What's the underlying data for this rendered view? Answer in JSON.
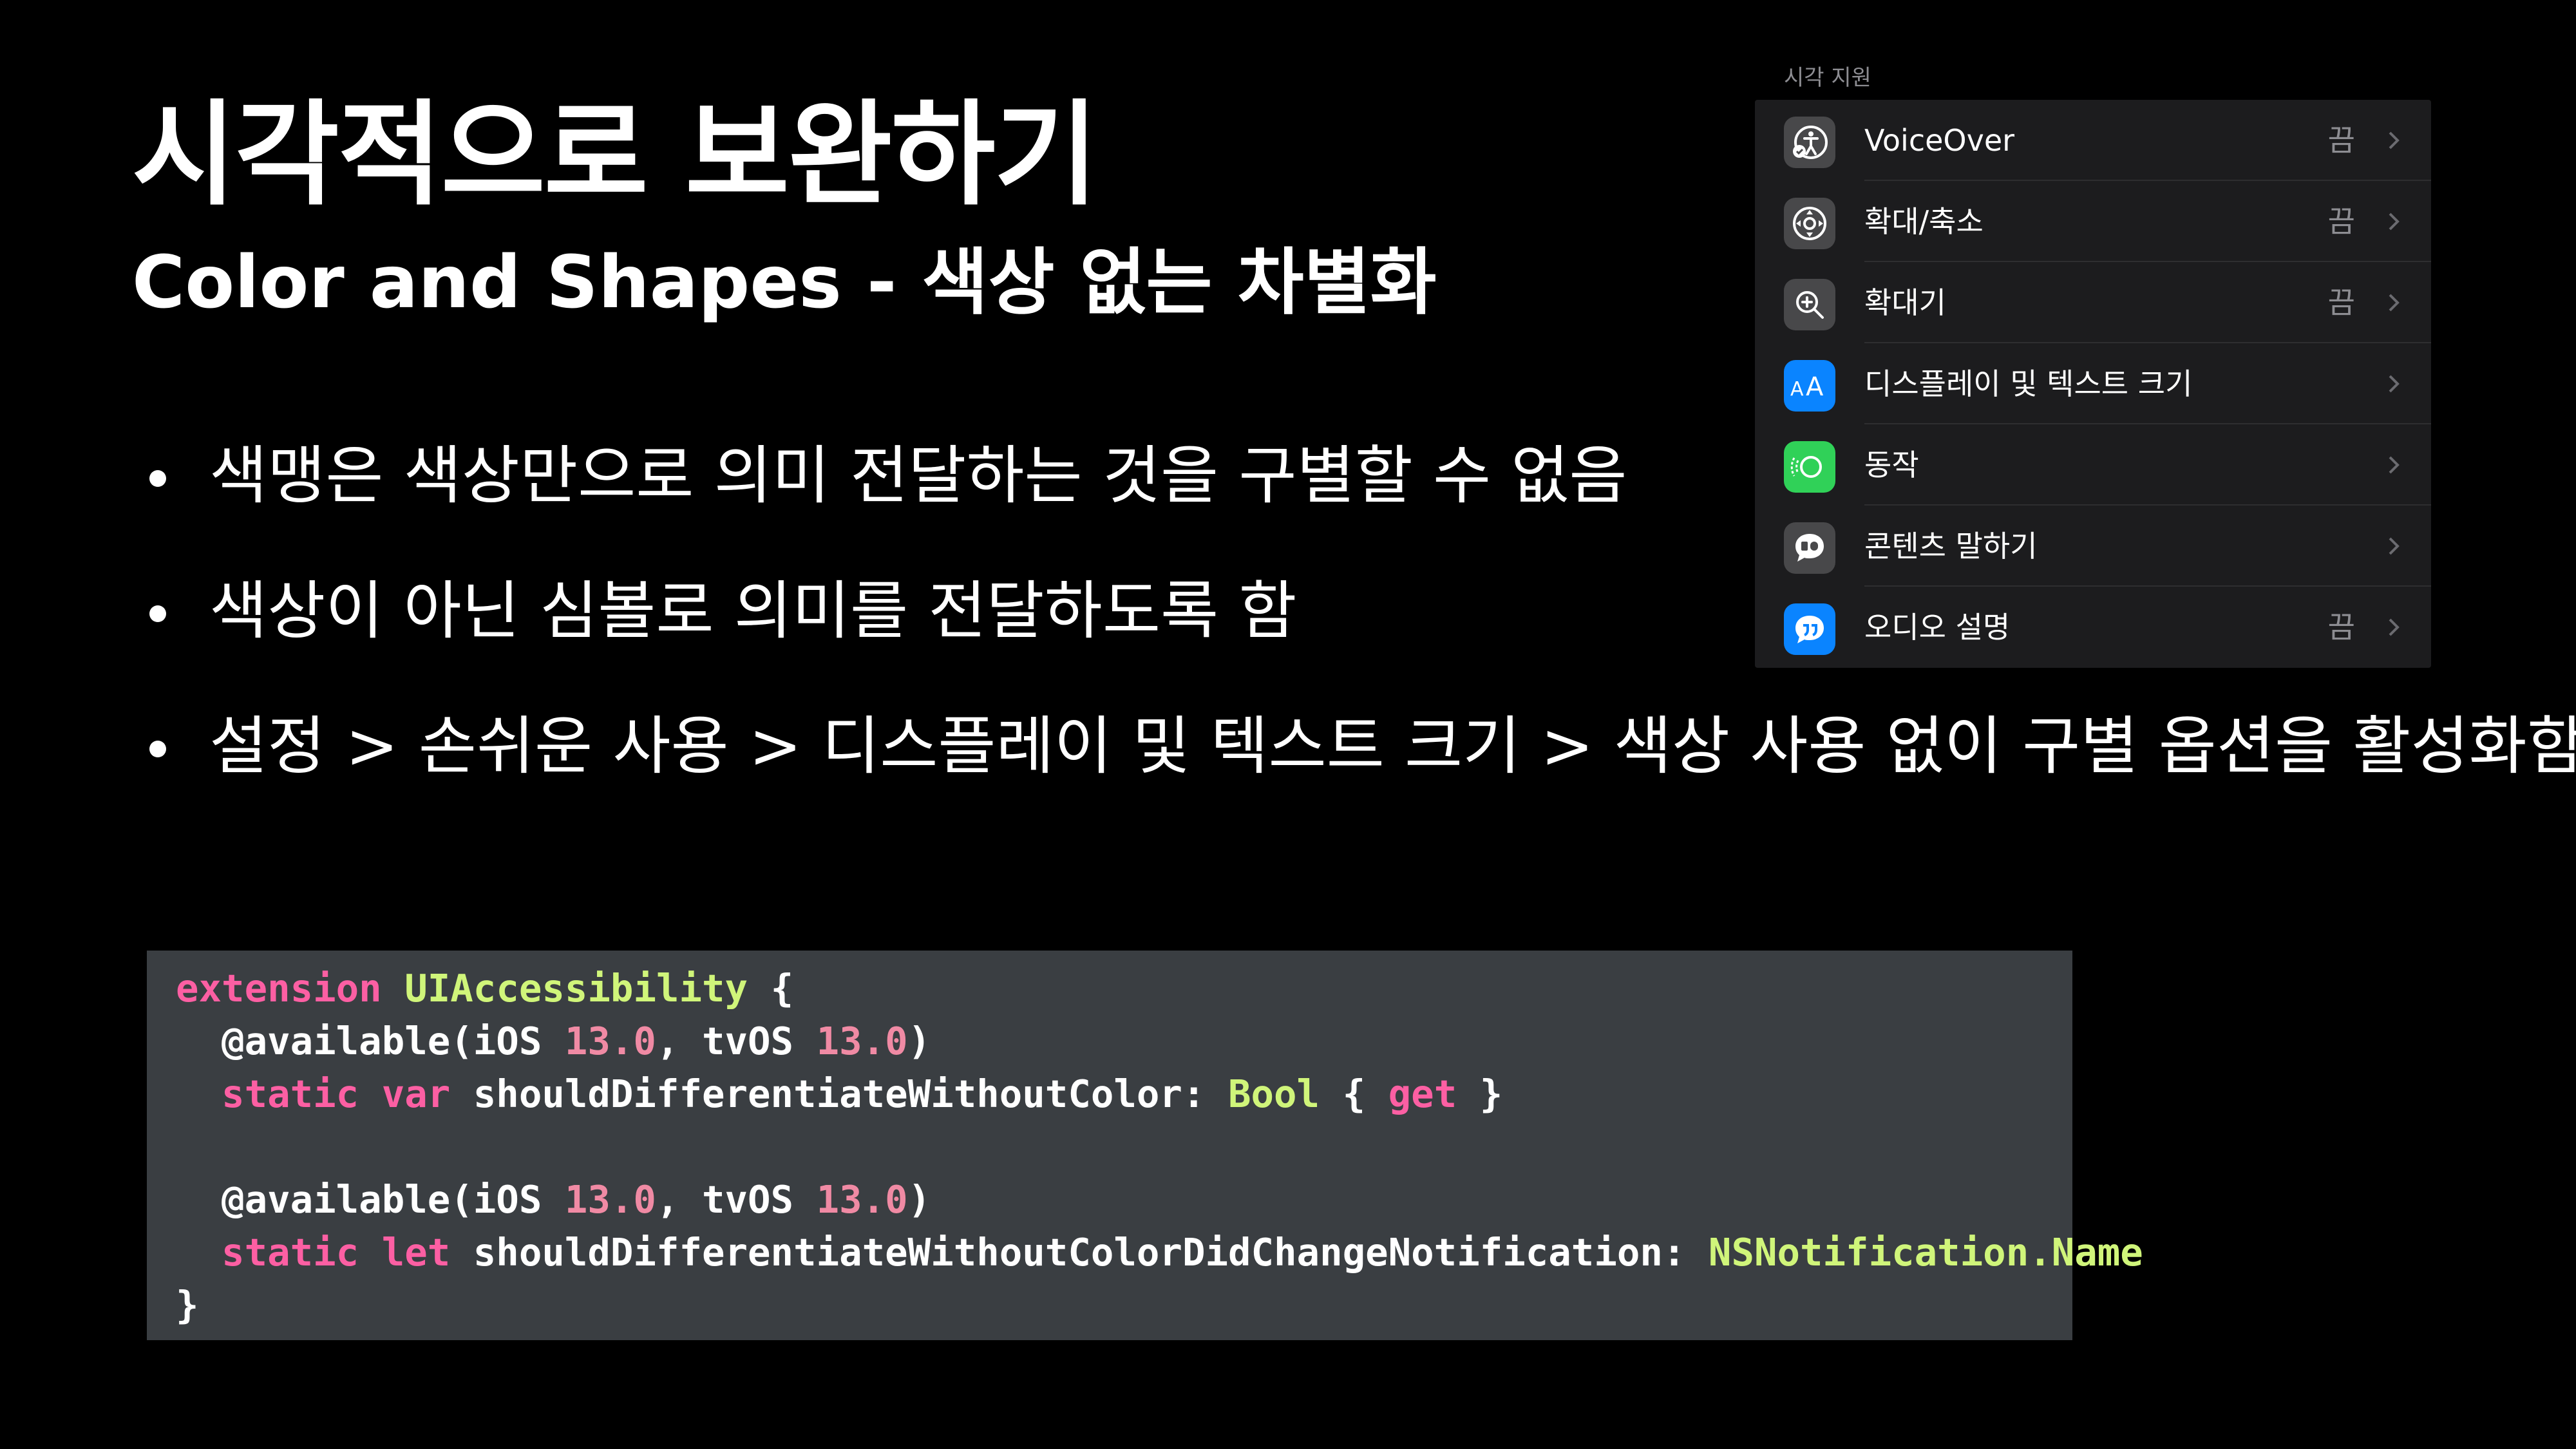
{
  "slide": {
    "title": "시각적으로 보완하기",
    "subtitle": "Color and Shapes - 색상 없는 차별화",
    "bullets": [
      "색맹은 색상만으로 의미 전달하는 것을 구별할 수 없음",
      "색상이 아닌 심볼로 의미를 전달하도록 함",
      "설정 > 손쉬운 사용 > 디스플레이 및 텍스트 크기 > 색상 사용 없이 구별 옵션을 활성화함"
    ]
  },
  "settings_panel": {
    "section_title": "시각 지원",
    "rows": [
      {
        "label": "VoiceOver",
        "value": "끔",
        "icon": "voiceover-icon",
        "icon_color": "#48484a"
      },
      {
        "label": "확대/축소",
        "value": "끔",
        "icon": "zoom-icon",
        "icon_color": "#48484a"
      },
      {
        "label": "확대기",
        "value": "끔",
        "icon": "magnifier-icon",
        "icon_color": "#48484a"
      },
      {
        "label": "디스플레이 및 텍스트 크기",
        "value": "",
        "icon": "text-size-icon",
        "icon_color": "#0a84ff"
      },
      {
        "label": "동작",
        "value": "",
        "icon": "motion-icon",
        "icon_color": "#30d158"
      },
      {
        "label": "콘텐츠 말하기",
        "value": "",
        "icon": "speech-icon",
        "icon_color": "#48484a"
      },
      {
        "label": "오디오 설명",
        "value": "끔",
        "icon": "audio-description-icon",
        "icon_color": "#0a84ff"
      }
    ]
  },
  "code": {
    "l1_kw": "extension",
    "l1_type": "UIAccessibility",
    "l1_rest": " {",
    "l2_attr": "  @available(iOS ",
    "l2_n1": "13.0",
    "l2_mid": ", tvOS ",
    "l2_n2": "13.0",
    "l2_end": ")",
    "l3_kw": "  static var",
    "l3_name": " shouldDifferentiateWithoutColor: ",
    "l3_type": "Bool",
    "l3_brace": " { ",
    "l3_get": "get",
    "l3_end": " }",
    "l5_attr": "  @available(iOS ",
    "l5_n1": "13.0",
    "l5_mid": ", tvOS ",
    "l5_n2": "13.0",
    "l5_end": ")",
    "l6_kw": "  static let",
    "l6_name": " shouldDifferentiateWithoutColorDidChangeNotification: ",
    "l6_type": "NSNotification.Name",
    "l7": "}"
  }
}
